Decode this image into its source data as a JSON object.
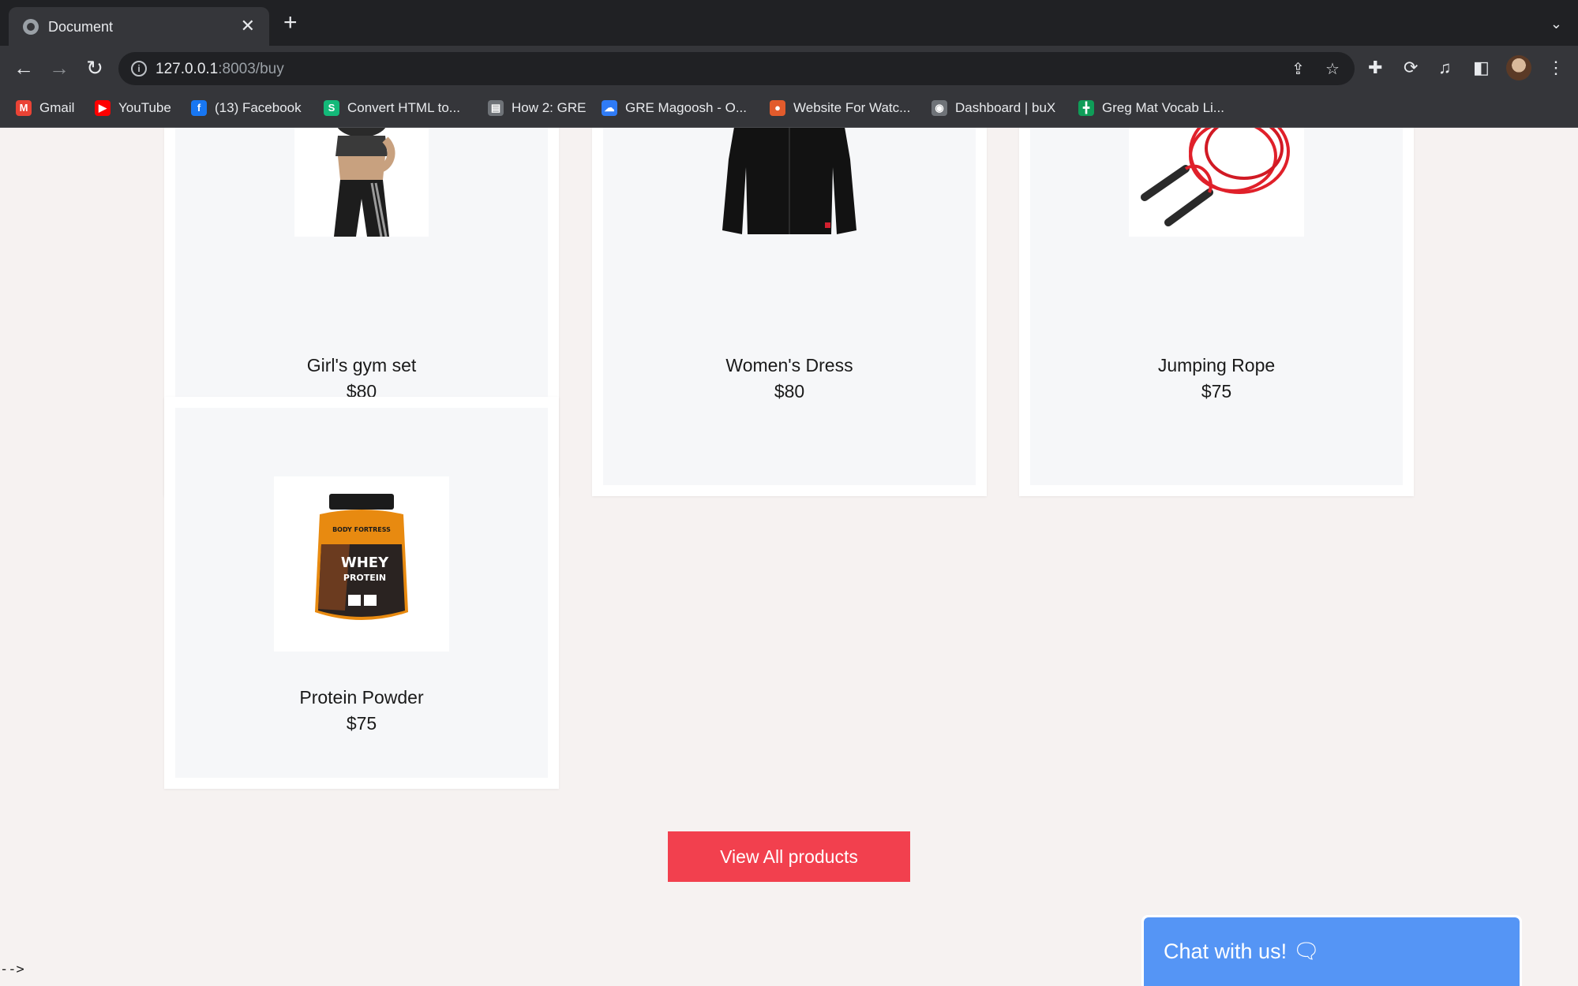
{
  "browser": {
    "tab_title": "Document",
    "tab_close": "✕",
    "new_tab": "+",
    "tab_menu": "⌄",
    "url_host": "127.0.0.1",
    "url_rest": ":8003/buy",
    "bookmarks": [
      {
        "label": "Gmail",
        "icon": "gmail-icon",
        "color": "#ea4335",
        "glyph": "M"
      },
      {
        "label": "YouTube",
        "icon": "youtube-icon",
        "color": "#ff0000",
        "glyph": "▶"
      },
      {
        "label": "(13) Facebook",
        "icon": "facebook-icon",
        "color": "#1877f2",
        "glyph": "f"
      },
      {
        "label": "Convert HTML to...",
        "icon": "convert-icon",
        "color": "#13b979",
        "glyph": "S"
      },
      {
        "label": "How 2: GRE",
        "icon": "document-icon",
        "color": "#6f7378",
        "glyph": "▤"
      },
      {
        "label": "GRE Magoosh - O...",
        "icon": "cloud-icon",
        "color": "#2f7bf5",
        "glyph": "☁"
      },
      {
        "label": "Website For Watc...",
        "icon": "website-icon",
        "color": "#e25b2c",
        "glyph": "●"
      },
      {
        "label": "Dashboard | buX",
        "icon": "dashboard-icon",
        "color": "#6f7378",
        "glyph": "◉"
      },
      {
        "label": "Greg Mat Vocab Li...",
        "icon": "sheets-icon",
        "color": "#0f9d58",
        "glyph": "╋"
      }
    ]
  },
  "products": [
    {
      "name": "Girl's gym set",
      "price": "$80"
    },
    {
      "name": "Women's Dress",
      "price": "$80"
    },
    {
      "name": "Jumping Rope",
      "price": "$75"
    },
    {
      "name": "Protein Powder",
      "price": "$75",
      "tub_brand": "BODY FORTRESS",
      "tub_line1": "WHEY",
      "tub_line2": "PROTEIN"
    }
  ],
  "view_all_label": "View All products",
  "chat_label": "Chat with us! 🗨",
  "stray_text": "-->",
  "colors": {
    "accent_button": "#f2404e",
    "chat_button": "#5595f5",
    "page_bg": "#f6f2f1"
  }
}
